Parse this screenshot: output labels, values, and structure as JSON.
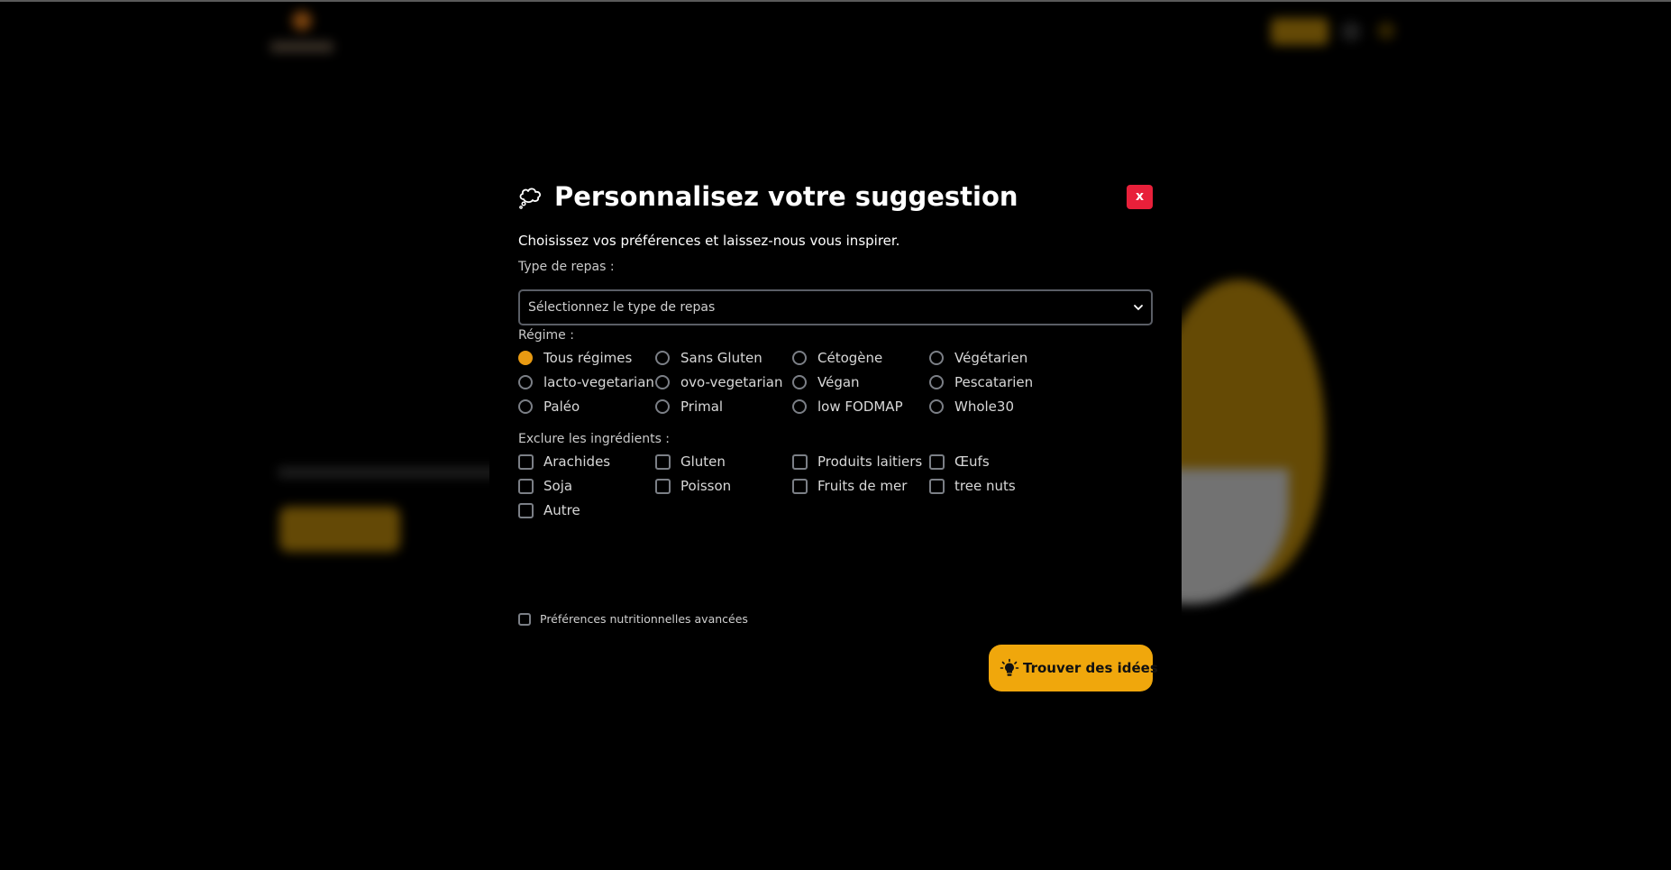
{
  "modal": {
    "title": "Personnalisez votre suggestion",
    "title_icon": "thought-bubble-icon",
    "close_label": "x",
    "intro": "Choisissez vos préférences et laissez-nous vous inspirer.",
    "meal_type": {
      "label": "Type de repas :",
      "placeholder": "Sélectionnez le type de repas"
    },
    "diet": {
      "label": "Régime :",
      "selected": "Tous régimes",
      "options": [
        "Tous régimes",
        "Sans Gluten",
        "Cétogène",
        "Végétarien",
        "lacto-vegetarian",
        "ovo-vegetarian",
        "Végan",
        "Pescatarien",
        "Paléo",
        "Primal",
        "low FODMAP",
        "Whole30"
      ]
    },
    "exclude": {
      "label": "Exclure les ingrédients :",
      "options": [
        "Arachides",
        "Gluten",
        "Produits laitiers",
        "Œufs",
        "Soja",
        "Poisson",
        "Fruits de mer",
        "tree nuts",
        "Autre"
      ]
    },
    "advanced_label": "Préférences nutritionnelles avancées",
    "submit_label": "Trouver des idées",
    "submit_icon": "lightbulb-icon"
  },
  "colors": {
    "accent": "#f0a70c",
    "close": "#e8203a",
    "background": "#000000"
  }
}
